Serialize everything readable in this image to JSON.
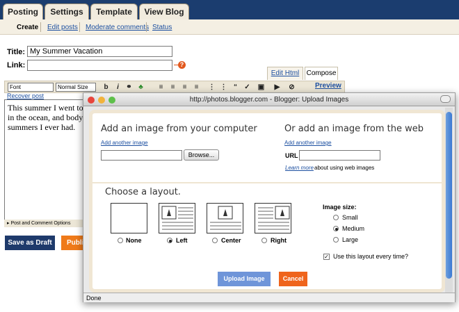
{
  "top_tabs": [
    "Posting",
    "Settings",
    "Template",
    "View Blog"
  ],
  "sub_tabs": [
    "Create",
    "Edit posts",
    "Moderate comments",
    "Status"
  ],
  "form": {
    "title_label": "Title:",
    "title_value": "My Summer Vacation",
    "link_label": "Link:",
    "link_value": "",
    "help_icon": "?"
  },
  "mode_tabs": [
    "Edit Html",
    "Compose"
  ],
  "toolbar": {
    "font_select": "Font",
    "size_select": "Normal Size",
    "bold": "b",
    "italic": "i",
    "preview": "Preview",
    "recover_post": "Recover post",
    "icons": [
      "font-select-icon",
      "size-select-icon",
      "bold-icon",
      "italic-icon",
      "link-icon",
      "color-icon",
      "align-left-icon",
      "align-center-icon",
      "align-right-icon",
      "justify-icon",
      "numbered-list-icon",
      "bullet-list-icon",
      "blockquote-icon",
      "spellcheck-icon",
      "image-icon",
      "video-icon",
      "remove-format-icon"
    ]
  },
  "editor_text": "This summer I went to\nin the ocean, and body\nsummers I ever had.",
  "post_options": "Post and Comment Options",
  "buttons": {
    "save_draft": "Save as Draft",
    "publish": "Publis"
  },
  "dialog": {
    "title": "http://photos.blogger.com - Blogger: Upload Images",
    "computer_heading": "Add an image from your computer",
    "web_heading": "Or add an image from the web",
    "add_another_1": "Add another image",
    "add_another_2": "Add another image",
    "browse": "Browse...",
    "url_label": "URL",
    "learn_more": "Learn more",
    "learn_more_rest": "about using web images",
    "layout_heading": "Choose a layout.",
    "layouts": [
      "None",
      "Left",
      "Center",
      "Right"
    ],
    "selected_layout": "Left",
    "thumb_text": "I never thought I'd see the day when the hour is up. You can take a horse",
    "size_heading": "Image size:",
    "sizes": [
      "Small",
      "Medium",
      "Large"
    ],
    "selected_size": "Medium",
    "remember_label": "Use this layout every time?",
    "remember_checked": true,
    "upload_button": "Upload Image",
    "cancel_button": "Cancel",
    "status": "Done"
  },
  "colors": {
    "navy": "#1b3d6f",
    "orange": "#ef7a1a",
    "link": "#1c4fa0",
    "upload_blue": "#6f95d9"
  }
}
